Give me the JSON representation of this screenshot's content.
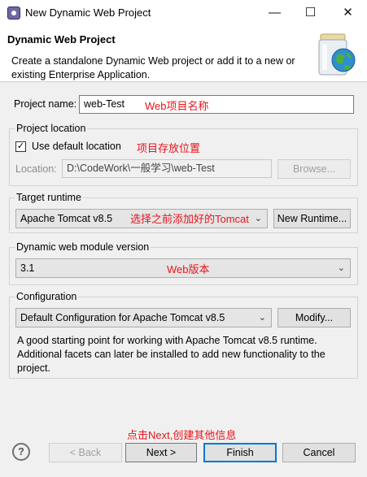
{
  "window": {
    "title": "New Dynamic Web Project",
    "minimize": "—",
    "maximize": "☐",
    "close": "✕"
  },
  "banner": {
    "title": "Dynamic Web Project",
    "description": "Create a standalone Dynamic Web project or add it to a new or existing Enterprise Application."
  },
  "project_name": {
    "label": "Project name:",
    "value": "web-Test",
    "annotation": "Web项目名称"
  },
  "project_location": {
    "group_label": "Project location",
    "use_default_label": "Use default location",
    "use_default_checked": true,
    "annotation": "项目存放位置",
    "location_label": "Location:",
    "location_value": "D:\\CodeWork\\一般学习\\web-Test",
    "browse_label": "Browse..."
  },
  "target_runtime": {
    "group_label": "Target runtime",
    "selected": "Apache Tomcat v8.5",
    "annotation": "选择之前添加好的Tomcat",
    "new_runtime_label": "New Runtime..."
  },
  "module_version": {
    "group_label": "Dynamic web module version",
    "selected": "3.1",
    "annotation": "Web版本"
  },
  "configuration": {
    "group_label": "Configuration",
    "selected": "Default Configuration for Apache Tomcat v8.5",
    "modify_label": "Modify...",
    "description": "A good starting point for working with Apache Tomcat v8.5 runtime. Additional facets can later be installed to add new functionality to the project."
  },
  "footer": {
    "annotation": "点击Next,创建其他信息",
    "help_icon": "?",
    "back_label": "< Back",
    "next_label": "Next >",
    "finish_label": "Finish",
    "cancel_label": "Cancel"
  },
  "colors": {
    "annotation": "#e8141b",
    "default_button_border": "#0078d7"
  }
}
